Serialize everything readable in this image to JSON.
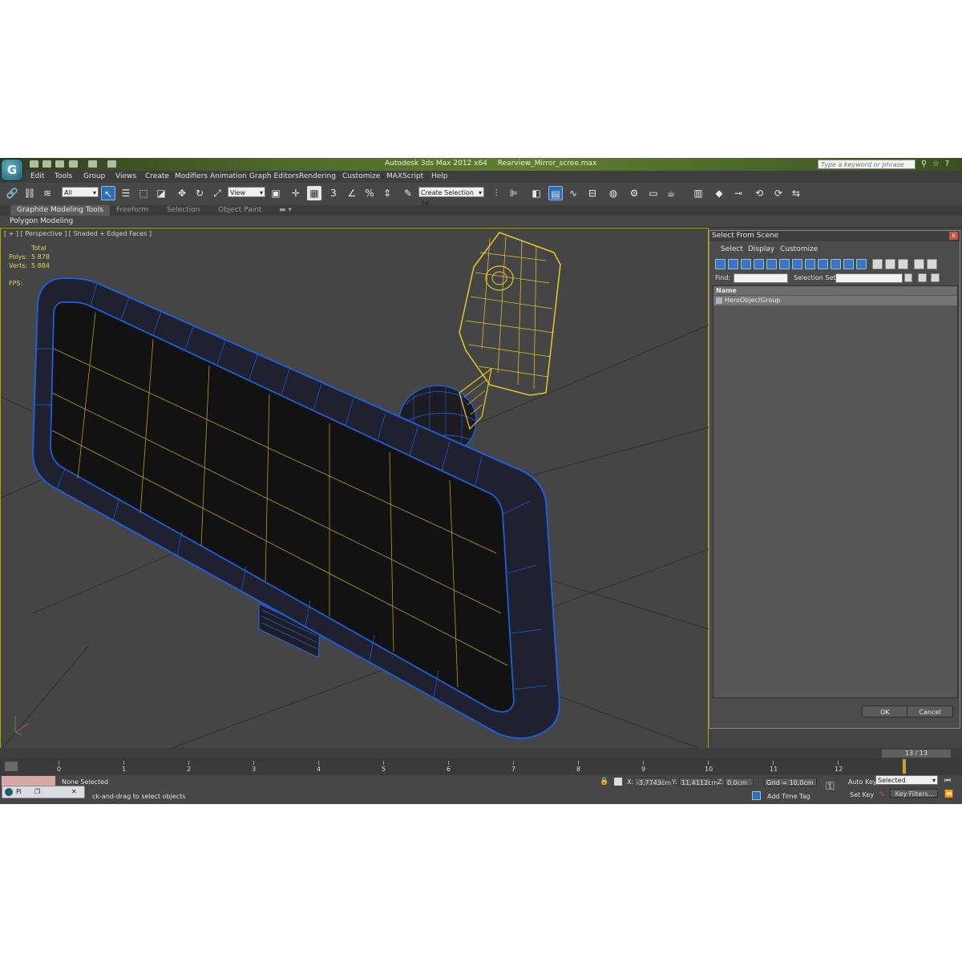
{
  "app": {
    "title": "Autodesk 3ds Max  2012 x64",
    "filename": "Rearview_Mirror_scree.max",
    "logo": "G",
    "search_placeholder": "Type a keyword or phrase"
  },
  "menu": [
    "Edit",
    "Tools",
    "Group",
    "Views",
    "Create",
    "Modifiers",
    "Animation",
    "Graph Editors",
    "Rendering",
    "Customize",
    "MAXScript",
    "Help"
  ],
  "toolbar": {
    "selection_filter": "All",
    "ref_coord": "View",
    "angle_snap": "3",
    "named_selection": "Create Selection Se"
  },
  "ribbon": {
    "tabs": [
      "Graphite Modeling Tools",
      "Freeform",
      "Selection",
      "Object Paint"
    ],
    "sub_label": "Polygon Modeling"
  },
  "viewport": {
    "label": "[ + ] [ Perspective ] [ Shaded + Edged Faces ]",
    "stats_header": "Total",
    "polys_label": "Polys:",
    "polys_value": "5 878",
    "verts_label": "Verts:",
    "verts_value": "5 884",
    "fps_label": "FPS:"
  },
  "dialog": {
    "title": "Select From Scene",
    "close": "x",
    "menu": [
      "Select",
      "Display",
      "Customize"
    ],
    "find_label": "Find:",
    "selection_set_label": "Selection Set:",
    "column_header": "Name",
    "rows": [
      "HeroObjectGroup"
    ],
    "ok_label": "OK",
    "cancel_label": "Cancel"
  },
  "timeline": {
    "frame_counter": "13 / 13",
    "ticks": [
      "0",
      "1",
      "2",
      "3",
      "4",
      "5",
      "6",
      "7",
      "8",
      "9",
      "10",
      "11",
      "12"
    ]
  },
  "status": {
    "selection": "None Selected",
    "prompt": "ck-and-drag to select objects",
    "x_label": "X:",
    "x_value": "-3,7743cm",
    "y_label": "Y:",
    "y_value": "11,4112cm",
    "z_label": "Z:",
    "z_value": "0,0cm",
    "grid": "Grid = 10,0cm",
    "add_time_tag": "Add Time Tag",
    "auto_key": "Auto Key",
    "auto_key_mode": "Selected",
    "set_key": "Set Key",
    "key_filters": "Key Filters...",
    "taskbar_item": "Pi"
  },
  "colors": {
    "selection_wire": "#1f5fd6",
    "selected_object_wire": "#e8c72e",
    "viewport_bg": "#454545",
    "dialog_highlight": "#3777c2"
  }
}
